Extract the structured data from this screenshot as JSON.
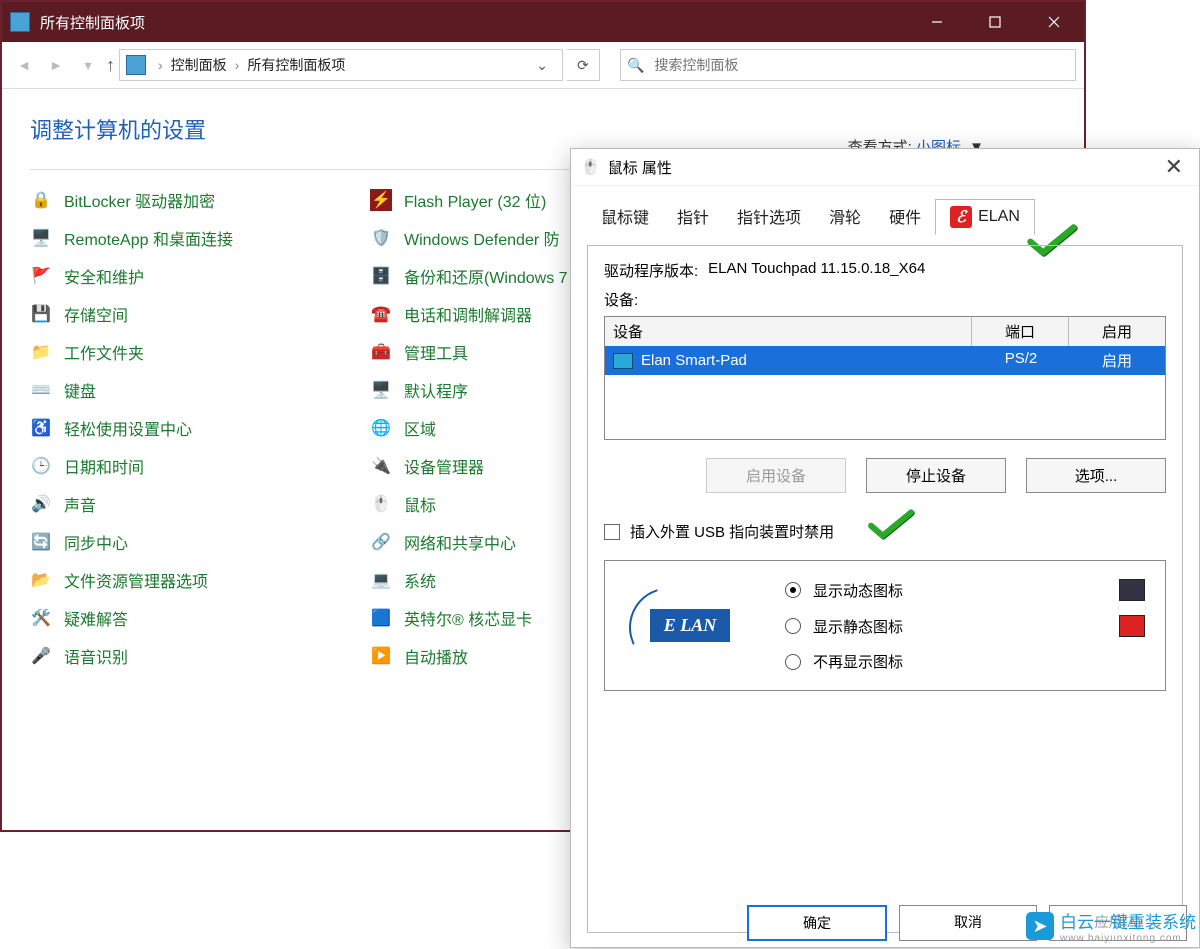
{
  "window": {
    "title": "所有控制面板项",
    "breadcrumb": {
      "root": "控制面板",
      "current": "所有控制面板项"
    },
    "search_placeholder": "搜索控制面板",
    "heading": "调整计算机的设置",
    "view_label": "查看方式:",
    "view_value": "小图标"
  },
  "cp_items_col1": [
    "BitLocker 驱动器加密",
    "RemoteApp 和桌面连接",
    "安全和维护",
    "存储空间",
    "工作文件夹",
    "键盘",
    "轻松使用设置中心",
    "日期和时间",
    "声音",
    "同步中心",
    "文件资源管理器选项",
    "疑难解答",
    "语音识别"
  ],
  "cp_items_col2": [
    "Flash Player (32 位)",
    "Windows Defender 防",
    "备份和还原(Windows 7",
    "电话和调制解调器",
    "管理工具",
    "默认程序",
    "区域",
    "设备管理器",
    "鼠标",
    "网络和共享中心",
    "系统",
    "英特尔® 核芯显卡",
    "自动播放"
  ],
  "dialog": {
    "title": "鼠标 属性",
    "tabs": [
      "鼠标键",
      "指针",
      "指针选项",
      "滑轮",
      "硬件",
      "ELAN"
    ],
    "driver_label": "驱动程序版本:",
    "driver_value": "ELAN Touchpad 11.15.0.18_X64",
    "device_label": "设备:",
    "table": {
      "headers": {
        "device": "设备",
        "port": "端口",
        "enabled": "启用"
      },
      "row": {
        "name": "Elan Smart-Pad",
        "port": "PS/2",
        "enabled": "启用"
      }
    },
    "buttons": {
      "enable": "启用设备",
      "stop": "停止设备",
      "options": "选项..."
    },
    "usb_checkbox": "插入外置 USB 指向装置时禁用",
    "radios": {
      "dynamic": "显示动态图标",
      "static": "显示静态图标",
      "none": "不再显示图标"
    },
    "footer": {
      "ok": "确定",
      "cancel": "取消",
      "apply": "应用(A)"
    }
  },
  "watermark": {
    "brand": "白云一键重装系统",
    "url": "www.baiyunxitong.com"
  }
}
